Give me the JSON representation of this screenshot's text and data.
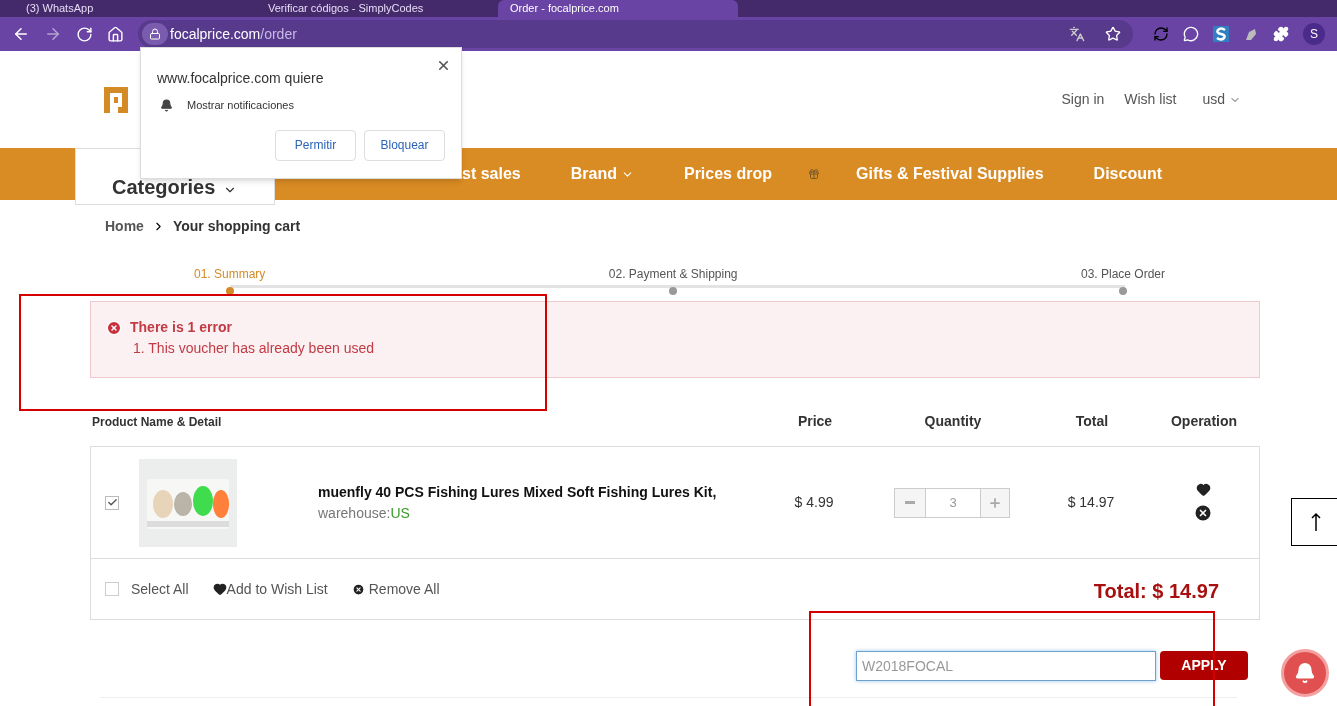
{
  "browser": {
    "tabs": [
      {
        "title": "(3) WhatsApp",
        "selected": false
      },
      {
        "title": "Verificar códigos - SimplyCodes",
        "selected": false
      },
      {
        "title": "Order - focalprice.com",
        "selected": true
      }
    ],
    "url_host": "focalprice.com",
    "url_path": "/order",
    "profile": "S"
  },
  "popup": {
    "title": "www.focalprice.com quiere",
    "permission": "Mostrar notificaciones",
    "buttons": [
      "Permitir",
      "Bloquear"
    ]
  },
  "header": {
    "links": [
      "Sign in",
      "Wish list"
    ],
    "currency": "usd"
  },
  "nav": {
    "categories": "Categories",
    "items": [
      {
        "kind": "link",
        "label": "st sales"
      },
      {
        "kind": "dropdown",
        "label": "Brand"
      },
      {
        "kind": "link",
        "label": "Prices drop"
      },
      {
        "kind": "gift"
      },
      {
        "kind": "link",
        "label": "Gifts & Festival Supplies"
      },
      {
        "kind": "link",
        "label": "Discount"
      }
    ]
  },
  "breadcrumb": [
    "Home",
    "Your shopping cart"
  ],
  "steps": [
    {
      "label": "01. Summary",
      "selected": true
    },
    {
      "label": "02. Payment & Shipping",
      "selected": false
    },
    {
      "label": "03. Place Order",
      "selected": false
    }
  ],
  "error": {
    "title": "There is 1 error",
    "messages": [
      "1. This voucher has already been used"
    ]
  },
  "table": {
    "columns": [
      "Product Name & Detail",
      "Price",
      "Quantity",
      "Total",
      "Operation"
    ],
    "rows": [
      {
        "checked": true,
        "name": "muenfly 40 PCS Fishing Lures Mixed Soft Fishing Lures Kit,",
        "warehouse_label": "warehouse:",
        "warehouse": "US",
        "price": "$ 4.99",
        "quantity": "3",
        "total": "$ 14.97"
      }
    ]
  },
  "footer": {
    "select_all": "Select All",
    "select_all_checked": false,
    "add_to_wish_list": "Add to Wish List",
    "remove_all": "Remove All",
    "total": "Total: $ 14.97"
  },
  "voucher": {
    "value": "W2018FOCAL",
    "button": "APPLY"
  }
}
